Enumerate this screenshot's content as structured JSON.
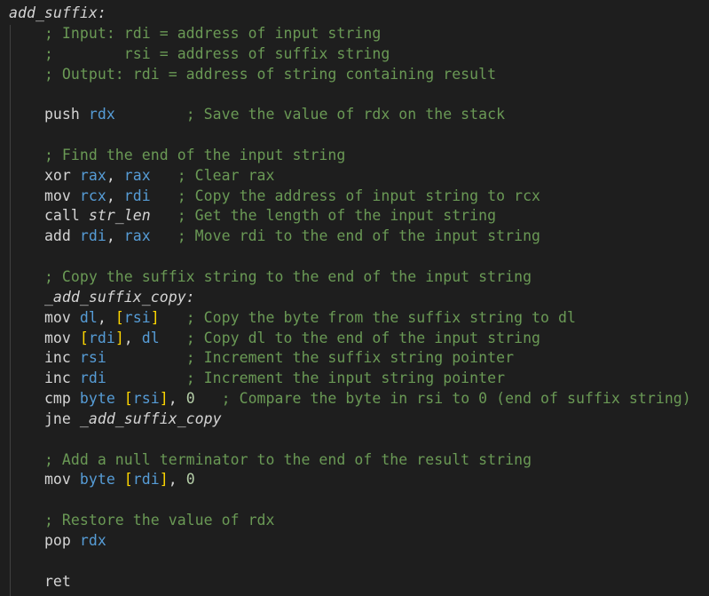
{
  "colors": {
    "background": "#1e1e1e",
    "text": "#d4d4d4",
    "comment": "#6a9955",
    "register": "#569cd6",
    "number": "#b5cea8",
    "bracket": "#ffd700"
  },
  "code": {
    "l01": {
      "label": "add_suffix:"
    },
    "l02": {
      "comment": "; Input: rdi = address of input string"
    },
    "l03": {
      "comment": ";        rsi = address of suffix string"
    },
    "l04": {
      "comment": "; Output: rdi = address of string containing result"
    },
    "l06": {
      "op": "push",
      "reg1": "rdx",
      "comment": "; Save the value of rdx on the stack"
    },
    "l08": {
      "comment": "; Find the end of the input string"
    },
    "l09": {
      "op": "xor",
      "reg1": "rax",
      "sep": ", ",
      "reg2": "rax",
      "comment": "; Clear rax"
    },
    "l10": {
      "op": "mov",
      "reg1": "rcx",
      "sep": ", ",
      "reg2": "rdi",
      "comment": "; Copy the address of input string to rcx"
    },
    "l11": {
      "op": "call",
      "target": "str_len",
      "comment": "; Get the length of the input string"
    },
    "l12": {
      "op": "add",
      "reg1": "rdi",
      "sep": ", ",
      "reg2": "rax",
      "comment": "; Move rdi to the end of the input string"
    },
    "l14": {
      "comment": "; Copy the suffix string to the end of the input string"
    },
    "l15": {
      "label": "_add_suffix_copy:"
    },
    "l16": {
      "op": "mov",
      "reg1": "dl",
      "sep": ", ",
      "lb": "[",
      "reg2": "rsi",
      "rb": "]",
      "comment": "; Copy the byte from the suffix string to dl"
    },
    "l17": {
      "op": "mov",
      "lb": "[",
      "reg1": "rdi",
      "rb": "]",
      "sep": ", ",
      "reg2": "dl",
      "comment": "; Copy dl to the end of the input string"
    },
    "l18": {
      "op": "inc",
      "reg1": "rsi",
      "comment": "; Increment the suffix string pointer"
    },
    "l19": {
      "op": "inc",
      "reg1": "rdi",
      "comment": "; Increment the input string pointer"
    },
    "l20": {
      "op": "cmp",
      "size": "byte",
      "lb": "[",
      "reg1": "rsi",
      "rb": "]",
      "sep": ", ",
      "num": "0",
      "comment": "; Compare the byte in rsi to 0 (end of suffix string)"
    },
    "l21": {
      "op": "jne",
      "target": "_add_suffix_copy"
    },
    "l23": {
      "comment": "; Add a null terminator to the end of the result string"
    },
    "l24": {
      "op": "mov",
      "size": "byte",
      "lb": "[",
      "reg1": "rdi",
      "rb": "]",
      "sep": ", ",
      "num": "0"
    },
    "l26": {
      "comment": "; Restore the value of rdx"
    },
    "l27": {
      "op": "pop",
      "reg1": "rdx"
    },
    "l29": {
      "op": "ret"
    }
  }
}
